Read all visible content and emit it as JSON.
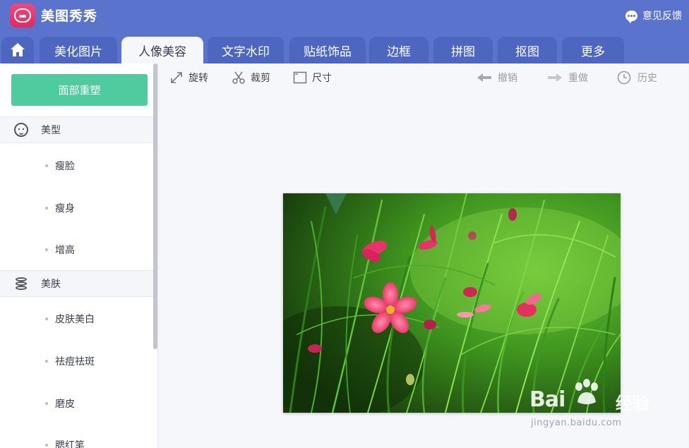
{
  "app": {
    "title": "美图秀秀",
    "feedback_label": "意见反馈"
  },
  "tabs": [
    {
      "label": ""
    },
    {
      "label": "美化图片"
    },
    {
      "label": "人像美容"
    },
    {
      "label": "文字水印"
    },
    {
      "label": "贴纸饰品"
    },
    {
      "label": "边框"
    },
    {
      "label": "拼图"
    },
    {
      "label": "抠图"
    },
    {
      "label": "更多"
    }
  ],
  "sidebar": {
    "primary_button": "面部重塑",
    "sections": [
      {
        "title": "美型",
        "icon": "face-icon",
        "items": [
          "瘦脸",
          "瘦身",
          "增高"
        ]
      },
      {
        "title": "美肤",
        "icon": "skin-icon",
        "items": [
          "皮肤美白",
          "祛痘祛斑",
          "磨皮",
          "腮红笔"
        ]
      }
    ]
  },
  "toolbar": {
    "rotate": "旋转",
    "crop": "裁剪",
    "size": "尺寸",
    "undo": "撤销",
    "redo": "重做",
    "history": "历史"
  },
  "watermark": {
    "brand": "Bai",
    "brand_cn": "经验",
    "url": "jingyan.baidu.com"
  },
  "colors": {
    "header": "#5a74cd",
    "tab": "#4d66bf",
    "accent_button": "#4fcba0",
    "logo": "#e9346c"
  }
}
